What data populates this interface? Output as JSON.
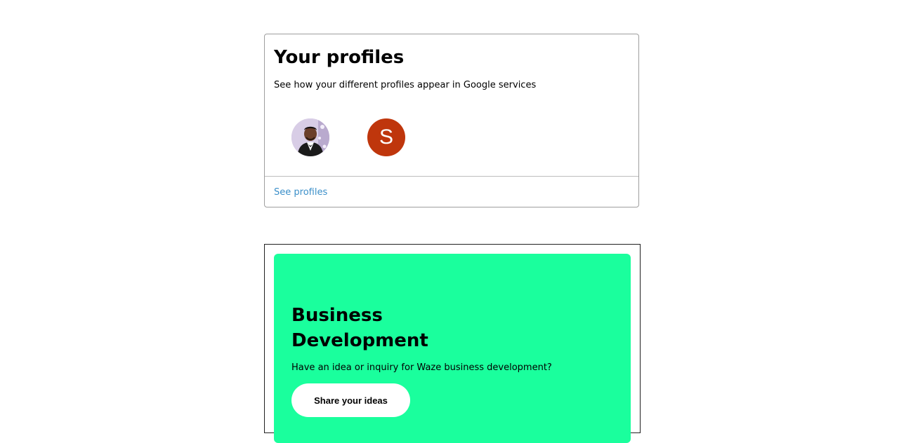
{
  "profiles_card": {
    "title": "Your profiles",
    "subtitle": "See how your different profiles appear in Google services",
    "avatars": [
      {
        "type": "photo",
        "icon": "user-photo-avatar"
      },
      {
        "type": "letter",
        "letter": "S",
        "color": "#bf360c"
      }
    ],
    "link_label": "See profiles"
  },
  "business_card": {
    "background_color": "#1aff9d",
    "title": "Business Development",
    "description": "Have an idea or inquiry for Waze business development?",
    "button_label": "Share your ideas"
  }
}
